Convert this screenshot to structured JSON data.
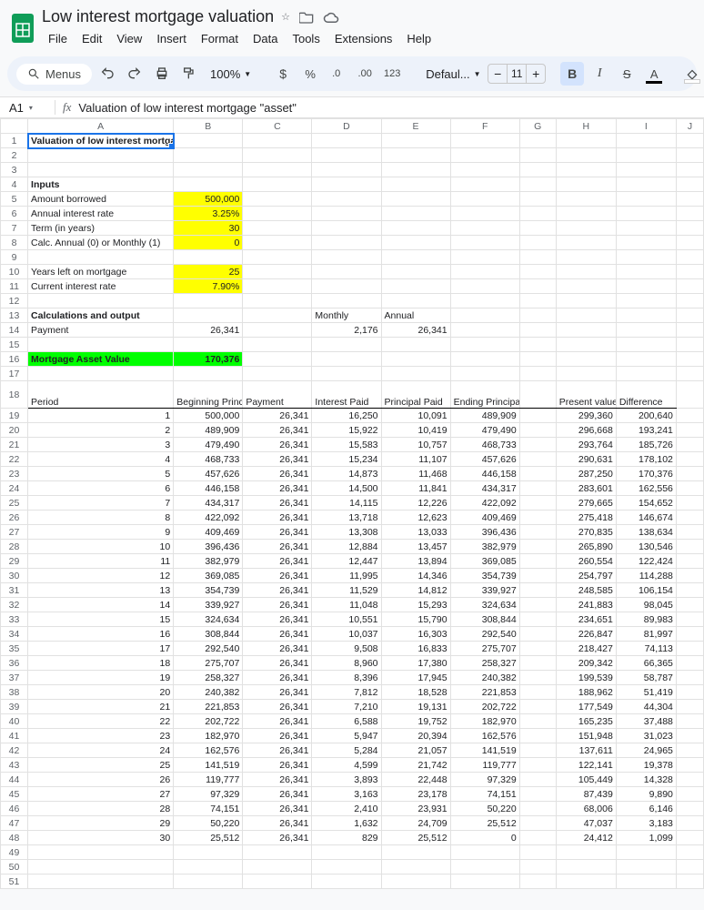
{
  "app": {
    "title": "Low interest mortgage valuation",
    "menus": [
      "File",
      "Edit",
      "View",
      "Insert",
      "Format",
      "Data",
      "Tools",
      "Extensions",
      "Help"
    ],
    "menus_label": "Menus",
    "zoom": "100%",
    "font": "Defaul...",
    "font_size": "11",
    "namebox": "A1",
    "formula": "Valuation of low interest mortgage \"asset\""
  },
  "columns": [
    "A",
    "B",
    "C",
    "D",
    "E",
    "F",
    "G",
    "H",
    "I",
    "J"
  ],
  "cells": {
    "A1": "Valuation of low interest mortgage \"asset\"",
    "A4": "Inputs",
    "A5": "Amount borrowed",
    "B5": "500,000",
    "A6": "Annual interest rate",
    "B6": "3.25%",
    "A7": "Term (in years)",
    "B7": "30",
    "A8": "Calc. Annual (0) or Monthly (1)",
    "B8": "0",
    "A10": "Years left on mortgage",
    "B10": "25",
    "A11": "Current interest rate",
    "B11": "7.90%",
    "A13": "Calculations and output",
    "D13": "Monthly",
    "E13": "Annual",
    "A14": "Payment",
    "B14": "26,341",
    "D14": "2,176",
    "E14": "26,341",
    "A16": "Mortgage Asset Value",
    "B16": "170,376",
    "A18": "Period",
    "B18": "Beginning Principal",
    "C18": "Payment",
    "D18": "Interest Paid",
    "E18": "Principal Paid",
    "F18": "Ending Principal",
    "H18": "Present value",
    "I18": "Difference"
  },
  "rows": [
    {
      "n": 1,
      "bp": "500,000",
      "pay": "26,341",
      "ip": "16,250",
      "pp": "10,091",
      "ep": "489,909",
      "pv": "299,360",
      "diff": "200,640"
    },
    {
      "n": 2,
      "bp": "489,909",
      "pay": "26,341",
      "ip": "15,922",
      "pp": "10,419",
      "ep": "479,490",
      "pv": "296,668",
      "diff": "193,241"
    },
    {
      "n": 3,
      "bp": "479,490",
      "pay": "26,341",
      "ip": "15,583",
      "pp": "10,757",
      "ep": "468,733",
      "pv": "293,764",
      "diff": "185,726"
    },
    {
      "n": 4,
      "bp": "468,733",
      "pay": "26,341",
      "ip": "15,234",
      "pp": "11,107",
      "ep": "457,626",
      "pv": "290,631",
      "diff": "178,102"
    },
    {
      "n": 5,
      "bp": "457,626",
      "pay": "26,341",
      "ip": "14,873",
      "pp": "11,468",
      "ep": "446,158",
      "pv": "287,250",
      "diff": "170,376"
    },
    {
      "n": 6,
      "bp": "446,158",
      "pay": "26,341",
      "ip": "14,500",
      "pp": "11,841",
      "ep": "434,317",
      "pv": "283,601",
      "diff": "162,556"
    },
    {
      "n": 7,
      "bp": "434,317",
      "pay": "26,341",
      "ip": "14,115",
      "pp": "12,226",
      "ep": "422,092",
      "pv": "279,665",
      "diff": "154,652"
    },
    {
      "n": 8,
      "bp": "422,092",
      "pay": "26,341",
      "ip": "13,718",
      "pp": "12,623",
      "ep": "409,469",
      "pv": "275,418",
      "diff": "146,674"
    },
    {
      "n": 9,
      "bp": "409,469",
      "pay": "26,341",
      "ip": "13,308",
      "pp": "13,033",
      "ep": "396,436",
      "pv": "270,835",
      "diff": "138,634"
    },
    {
      "n": 10,
      "bp": "396,436",
      "pay": "26,341",
      "ip": "12,884",
      "pp": "13,457",
      "ep": "382,979",
      "pv": "265,890",
      "diff": "130,546"
    },
    {
      "n": 11,
      "bp": "382,979",
      "pay": "26,341",
      "ip": "12,447",
      "pp": "13,894",
      "ep": "369,085",
      "pv": "260,554",
      "diff": "122,424"
    },
    {
      "n": 12,
      "bp": "369,085",
      "pay": "26,341",
      "ip": "11,995",
      "pp": "14,346",
      "ep": "354,739",
      "pv": "254,797",
      "diff": "114,288"
    },
    {
      "n": 13,
      "bp": "354,739",
      "pay": "26,341",
      "ip": "11,529",
      "pp": "14,812",
      "ep": "339,927",
      "pv": "248,585",
      "diff": "106,154"
    },
    {
      "n": 14,
      "bp": "339,927",
      "pay": "26,341",
      "ip": "11,048",
      "pp": "15,293",
      "ep": "324,634",
      "pv": "241,883",
      "diff": "98,045"
    },
    {
      "n": 15,
      "bp": "324,634",
      "pay": "26,341",
      "ip": "10,551",
      "pp": "15,790",
      "ep": "308,844",
      "pv": "234,651",
      "diff": "89,983"
    },
    {
      "n": 16,
      "bp": "308,844",
      "pay": "26,341",
      "ip": "10,037",
      "pp": "16,303",
      "ep": "292,540",
      "pv": "226,847",
      "diff": "81,997"
    },
    {
      "n": 17,
      "bp": "292,540",
      "pay": "26,341",
      "ip": "9,508",
      "pp": "16,833",
      "ep": "275,707",
      "pv": "218,427",
      "diff": "74,113"
    },
    {
      "n": 18,
      "bp": "275,707",
      "pay": "26,341",
      "ip": "8,960",
      "pp": "17,380",
      "ep": "258,327",
      "pv": "209,342",
      "diff": "66,365"
    },
    {
      "n": 19,
      "bp": "258,327",
      "pay": "26,341",
      "ip": "8,396",
      "pp": "17,945",
      "ep": "240,382",
      "pv": "199,539",
      "diff": "58,787"
    },
    {
      "n": 20,
      "bp": "240,382",
      "pay": "26,341",
      "ip": "7,812",
      "pp": "18,528",
      "ep": "221,853",
      "pv": "188,962",
      "diff": "51,419"
    },
    {
      "n": 21,
      "bp": "221,853",
      "pay": "26,341",
      "ip": "7,210",
      "pp": "19,131",
      "ep": "202,722",
      "pv": "177,549",
      "diff": "44,304"
    },
    {
      "n": 22,
      "bp": "202,722",
      "pay": "26,341",
      "ip": "6,588",
      "pp": "19,752",
      "ep": "182,970",
      "pv": "165,235",
      "diff": "37,488"
    },
    {
      "n": 23,
      "bp": "182,970",
      "pay": "26,341",
      "ip": "5,947",
      "pp": "20,394",
      "ep": "162,576",
      "pv": "151,948",
      "diff": "31,023"
    },
    {
      "n": 24,
      "bp": "162,576",
      "pay": "26,341",
      "ip": "5,284",
      "pp": "21,057",
      "ep": "141,519",
      "pv": "137,611",
      "diff": "24,965"
    },
    {
      "n": 25,
      "bp": "141,519",
      "pay": "26,341",
      "ip": "4,599",
      "pp": "21,742",
      "ep": "119,777",
      "pv": "122,141",
      "diff": "19,378"
    },
    {
      "n": 26,
      "bp": "119,777",
      "pay": "26,341",
      "ip": "3,893",
      "pp": "22,448",
      "ep": "97,329",
      "pv": "105,449",
      "diff": "14,328"
    },
    {
      "n": 27,
      "bp": "97,329",
      "pay": "26,341",
      "ip": "3,163",
      "pp": "23,178",
      "ep": "74,151",
      "pv": "87,439",
      "diff": "9,890"
    },
    {
      "n": 28,
      "bp": "74,151",
      "pay": "26,341",
      "ip": "2,410",
      "pp": "23,931",
      "ep": "50,220",
      "pv": "68,006",
      "diff": "6,146"
    },
    {
      "n": 29,
      "bp": "50,220",
      "pay": "26,341",
      "ip": "1,632",
      "pp": "24,709",
      "ep": "25,512",
      "pv": "47,037",
      "diff": "3,183"
    },
    {
      "n": 30,
      "bp": "25,512",
      "pay": "26,341",
      "ip": "829",
      "pp": "25,512",
      "ep": "0",
      "pv": "24,412",
      "diff": "1,099"
    }
  ],
  "extra_rows": [
    "49",
    "50",
    "51"
  ]
}
